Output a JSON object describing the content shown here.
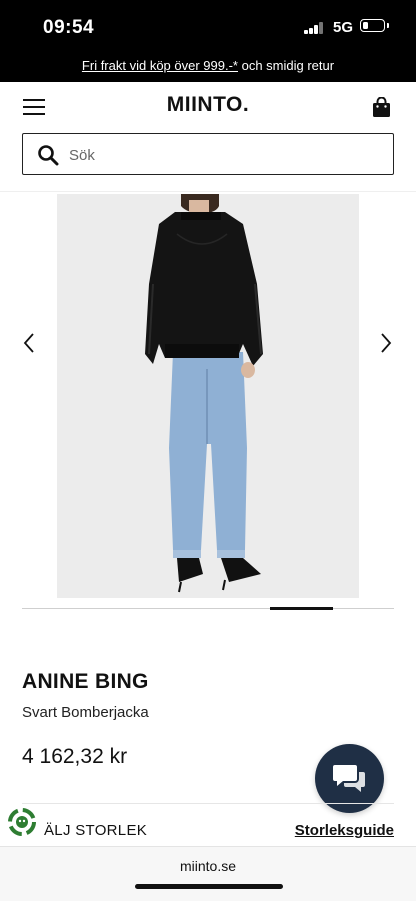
{
  "status": {
    "time": "09:54",
    "network": "5G",
    "battery_level": 0.3
  },
  "promo": {
    "link_text": "Fri frakt vid köp över 999.-*",
    "rest_text": " och smidig retur"
  },
  "header": {
    "logo": "MIINTO.",
    "menu_icon": "hamburger-menu-icon",
    "bag_icon": "shopping-bag-icon"
  },
  "search": {
    "placeholder": "Sök",
    "value": ""
  },
  "gallery": {
    "image": "product-photo",
    "prev_icon": "chevron-left-icon",
    "next_icon": "chevron-right-icon",
    "active_index": 4,
    "total_images": 6
  },
  "product": {
    "brand": "ANINE BING",
    "name": "Svart Bomberjacka",
    "price": "4 162,32 kr",
    "size_label": "ÄLJ STORLEK",
    "size_guide": "Storleksguide"
  },
  "browser": {
    "url": "miinto.se"
  },
  "colors": {
    "status_bar": "#000000",
    "chat_button": "#1f2f45",
    "recycle_badge": "#2e7d32"
  }
}
